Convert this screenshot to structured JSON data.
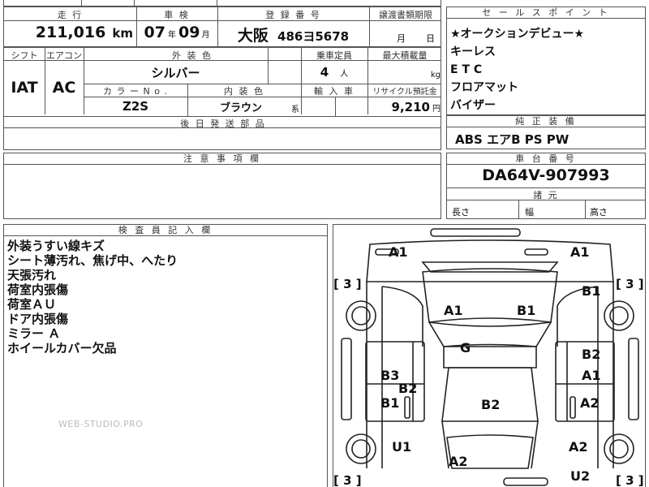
{
  "top": {
    "h_mileage": "走 行",
    "h_shaken": "車 検",
    "h_reg": "登 録 番 号",
    "h_transfer": "譲渡書類期限",
    "mileage": "211,016",
    "mileage_unit": "km",
    "shaken_year": "07",
    "shaken_year_unit": "年",
    "shaken_month": "09",
    "shaken_month_unit": "月",
    "reg_area": "大阪",
    "reg_number": "486ヨ5678",
    "transfer_month": "月",
    "transfer_day": "日"
  },
  "row2": {
    "h_shift": "シフト",
    "h_aircon": "エアコン",
    "h_exterior": "外 装 色",
    "h_capacity": "乗車定員",
    "h_maxload": "最大積載量",
    "shift": "IAT",
    "aircon": "AC",
    "exterior_color": "シルバー",
    "capacity": "4",
    "capacity_unit": "人",
    "maxload_unit": "kg",
    "h_colorno": "カ ラ ー N o .",
    "h_interior": "内 装 色",
    "h_import": "輸 入 車",
    "h_recycle": "リサイクル預託金",
    "color_no": "Z2S",
    "interior_color": "ブラウン",
    "interior_suffix": "系",
    "recycle_fee": "9,210",
    "recycle_unit": "円",
    "h_later_parts": "後 日 発 送 部 品"
  },
  "sales": {
    "header": "セ ー ル ス ポ イ ン ト",
    "points": [
      "★オークションデビュー★",
      "キーレス",
      "E T C",
      "フロアマット",
      "バイザー"
    ]
  },
  "equipment": {
    "header": "純 正 装 備",
    "value": "ABS エアB PS PW"
  },
  "caution": {
    "header": "注 意 事 項 欄"
  },
  "chassis": {
    "header": "車 台 番 号",
    "value": "DA64V-907993",
    "dims_header": "諸 元",
    "length": "長さ",
    "width": "幅",
    "height": "高さ"
  },
  "inspector": {
    "header": "検 査 員 記 入 欄",
    "notes": [
      "外装うすい線キズ",
      "シート薄汚れ、焦げ中、へたり",
      "天張汚れ",
      "荷室内張傷",
      "荷室ＡＵ",
      "ドア内張傷",
      "ミラー Ａ",
      "ホイールカバー欠品"
    ],
    "watermark": "WEB-STUDIO.PRO"
  },
  "diagram": {
    "bracket": "[ 3 ]",
    "marks": {
      "front_left_corner": "A1",
      "front_right_corner": "A1",
      "hood_left": "A1",
      "hood_right": "B1",
      "right_front_fender": "B1",
      "roof": "G",
      "left_door_upper": "B3",
      "left_door_mid": "B2",
      "left_door_lower": "B1",
      "center_body": "B2",
      "right_door_upper": "B2",
      "right_door_mid": "A1",
      "right_door_lower": "A2",
      "left_rear": "U1",
      "right_rear": "A2",
      "rear_center": "A2",
      "rear_right_bottom": "U2"
    }
  }
}
